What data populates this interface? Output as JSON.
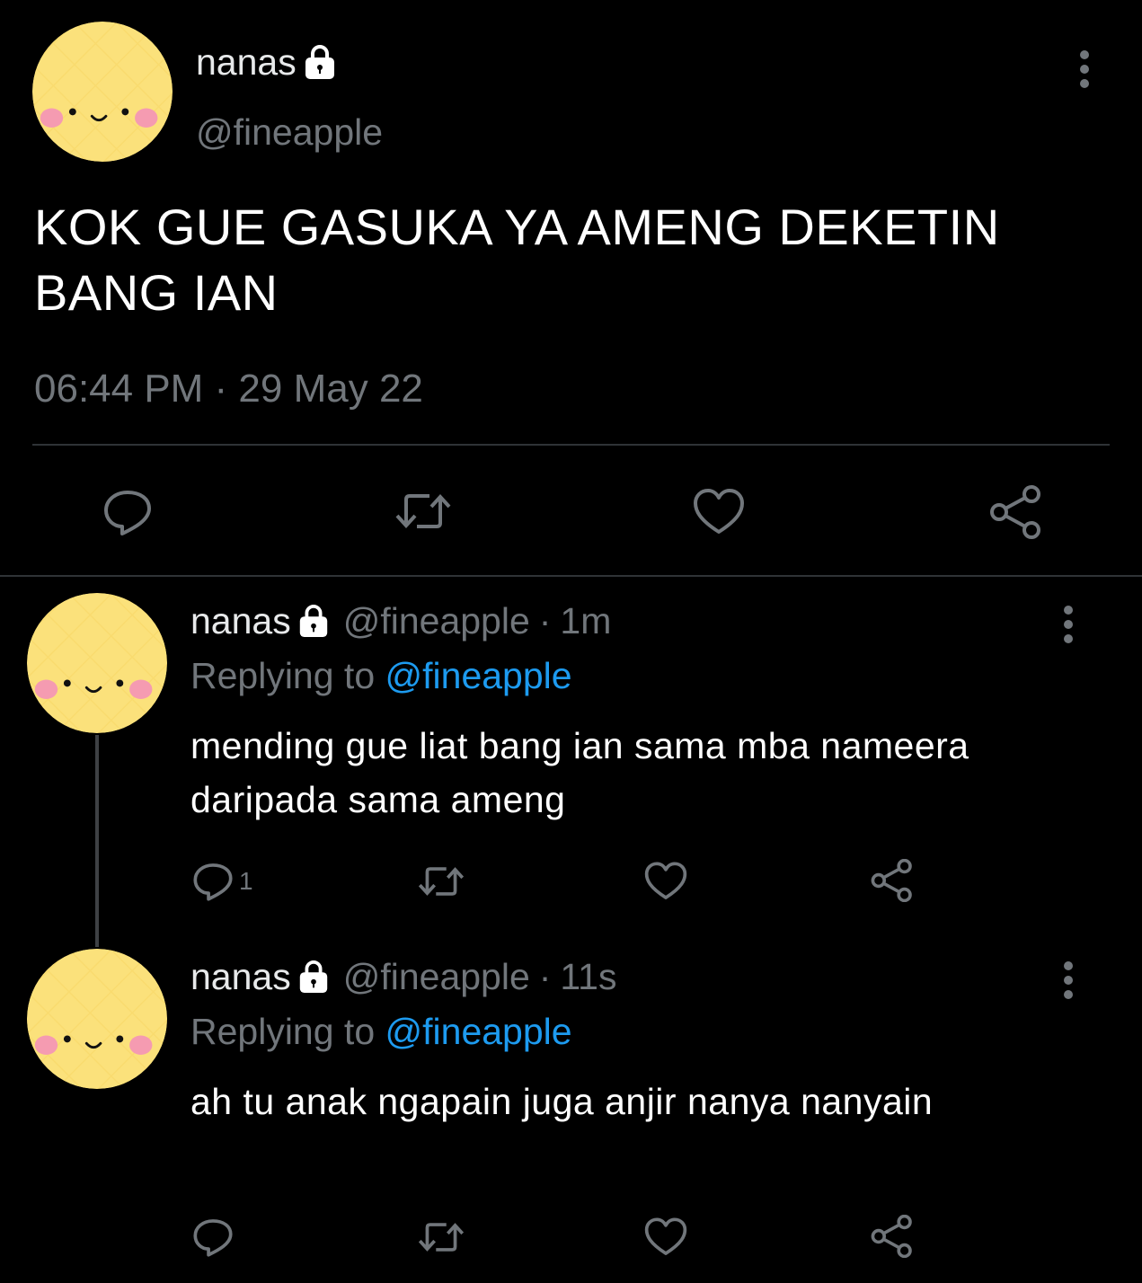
{
  "main_tweet": {
    "display_name": "nanas",
    "handle": "@fineapple",
    "text": "KOK GUE GASUKA YA AMENG DEKETIN BANG IAN",
    "timestamp": "06:44 PM · 29 May 22",
    "avatar_icon": "pineapple-face-icon"
  },
  "replies": [
    {
      "display_name": "nanas",
      "handle": "@fineapple",
      "separator": "·",
      "time": "1m",
      "replying_prefix": "Replying to",
      "replying_to": "@fineapple",
      "text": "mending gue liat bang ian sama mba nameera daripada sama ameng",
      "reply_count": "1"
    },
    {
      "display_name": "nanas",
      "handle": "@fineapple",
      "separator": "·",
      "time": "11s",
      "replying_prefix": "Replying to",
      "replying_to": "@fineapple",
      "text": "ah tu anak ngapain juga anjir nanya nanyain",
      "reply_count": ""
    }
  ],
  "colors": {
    "background": "#000000",
    "secondary_text": "#71767b",
    "mention": "#1d9bf0",
    "avatar_yellow": "#fbe17b",
    "blush": "#f59bb1"
  }
}
